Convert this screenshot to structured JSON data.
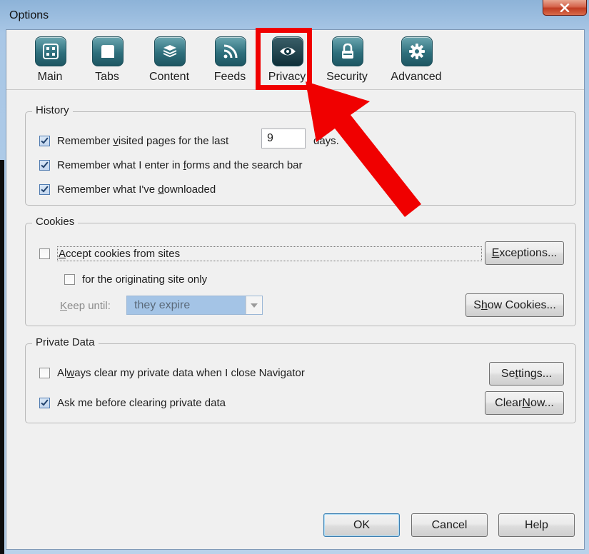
{
  "window": {
    "title": "Options"
  },
  "toolbar": {
    "items": [
      {
        "label": "Main",
        "icon": "main-grid-icon"
      },
      {
        "label": "Tabs",
        "icon": "tabs-icon"
      },
      {
        "label": "Content",
        "icon": "content-stack-icon"
      },
      {
        "label": "Feeds",
        "icon": "rss-feed-icon"
      },
      {
        "label": "Privacy",
        "icon": "privacy-eye-icon",
        "selected": true
      },
      {
        "label": "Security",
        "icon": "lock-icon"
      },
      {
        "label": "Advanced",
        "icon": "gear-icon"
      }
    ]
  },
  "history": {
    "legend": "History",
    "remember_pages": {
      "pre": "Remember ",
      "u": "v",
      "post": "isited pages for the last",
      "checked": true
    },
    "days_value": "9",
    "days_suffix": "days.",
    "remember_forms": {
      "pre": "Remember what I enter in ",
      "u": "f",
      "post": "orms and the search bar",
      "checked": true
    },
    "remember_downloads": {
      "pre": "Remember what I've ",
      "u": "d",
      "post": "ownloaded",
      "checked": true
    }
  },
  "cookies": {
    "legend": "Cookies",
    "accept": {
      "u": "A",
      "post": "ccept cookies from sites",
      "checked": false
    },
    "originating": {
      "label": "for the originating site only",
      "checked": false
    },
    "keep_until": {
      "u": "K",
      "post": "eep until:"
    },
    "keep_until_value": "they expire",
    "exceptions_btn": {
      "u": "E",
      "post": "xceptions..."
    },
    "show_cookies_btn": {
      "pre": "S",
      "u": "h",
      "post": "ow Cookies..."
    }
  },
  "private_data": {
    "legend": "Private Data",
    "always_clear": {
      "pre": "Al",
      "u": "w",
      "post": "ays clear my private data when I close Navigator",
      "checked": false
    },
    "ask_before": {
      "label": "Ask me before clearing private data",
      "checked": true
    },
    "settings_btn": {
      "pre": "Se",
      "u": "t",
      "post": "tings..."
    },
    "clear_now_btn": {
      "pre": "Clear ",
      "u": "N",
      "post": "ow..."
    }
  },
  "footer": {
    "ok": "OK",
    "cancel": "Cancel",
    "help": "Help"
  },
  "colors": {
    "highlight": "#f00000",
    "accent": "#2e6f7c"
  }
}
